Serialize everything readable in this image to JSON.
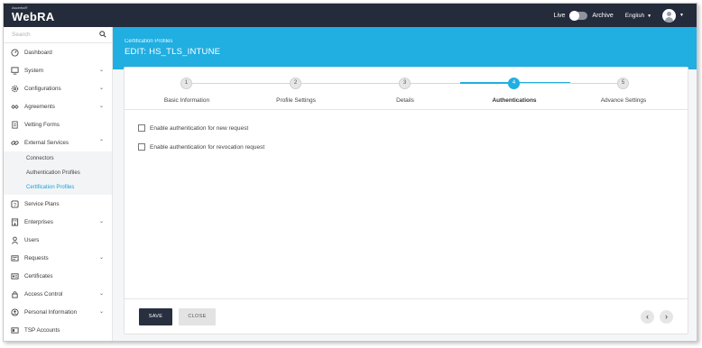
{
  "brand": {
    "tagline": "Ascertia®",
    "name": "WebRA"
  },
  "topbar": {
    "live_label": "Live",
    "archive_label": "Archive",
    "language": "English",
    "toggle_state": "live"
  },
  "sidebar": {
    "search_placeholder": "Search",
    "items": [
      {
        "label": "Dashboard",
        "icon": "dashboard-icon",
        "expandable": false
      },
      {
        "label": "System",
        "icon": "system-icon",
        "expandable": true
      },
      {
        "label": "Configurations",
        "icon": "gear-icon",
        "expandable": true
      },
      {
        "label": "Agreements",
        "icon": "handshake-icon",
        "expandable": true
      },
      {
        "label": "Vetting Forms",
        "icon": "form-icon",
        "expandable": false
      },
      {
        "label": "External Services",
        "icon": "link-icon",
        "expandable": true,
        "expanded": true
      },
      {
        "label": "Service Plans",
        "icon": "question-icon",
        "expandable": false
      },
      {
        "label": "Enterprises",
        "icon": "building-icon",
        "expandable": true
      },
      {
        "label": "Users",
        "icon": "user-icon",
        "expandable": false
      },
      {
        "label": "Requests",
        "icon": "requests-icon",
        "expandable": true
      },
      {
        "label": "Certificates",
        "icon": "certificate-icon",
        "expandable": false
      },
      {
        "label": "Access Control",
        "icon": "lock-icon",
        "expandable": true
      },
      {
        "label": "Personal Information",
        "icon": "person-circle-icon",
        "expandable": true
      },
      {
        "label": "TSP Accounts",
        "icon": "accounts-icon",
        "expandable": false
      }
    ],
    "sub_items": [
      {
        "label": "Connectors",
        "active": false
      },
      {
        "label": "Authentication Profiles",
        "active": false
      },
      {
        "label": "Certification Profiles",
        "active": true
      }
    ]
  },
  "header": {
    "breadcrumb": "Certification Profiles",
    "title": "EDIT: HS_TLS_INTUNE"
  },
  "stepper": {
    "current_step": 4,
    "steps": [
      {
        "number": "1",
        "label": "Basic Information"
      },
      {
        "number": "2",
        "label": "Profile Settings"
      },
      {
        "number": "3",
        "label": "Details"
      },
      {
        "number": "4",
        "label": "Authentications"
      },
      {
        "number": "5",
        "label": "Advance Settings"
      }
    ]
  },
  "options": {
    "new_request_label": "Enable authentication for new request",
    "new_request_checked": false,
    "revocation_label": "Enable authentication for revocation request",
    "revocation_checked": false
  },
  "actions": {
    "save_label": "SAVE",
    "close_label": "CLOSE",
    "prev_label": "‹",
    "next_label": "›"
  },
  "colors": {
    "topbar": "#242b3a",
    "accent": "#21aee1",
    "save_button": "#283040"
  }
}
